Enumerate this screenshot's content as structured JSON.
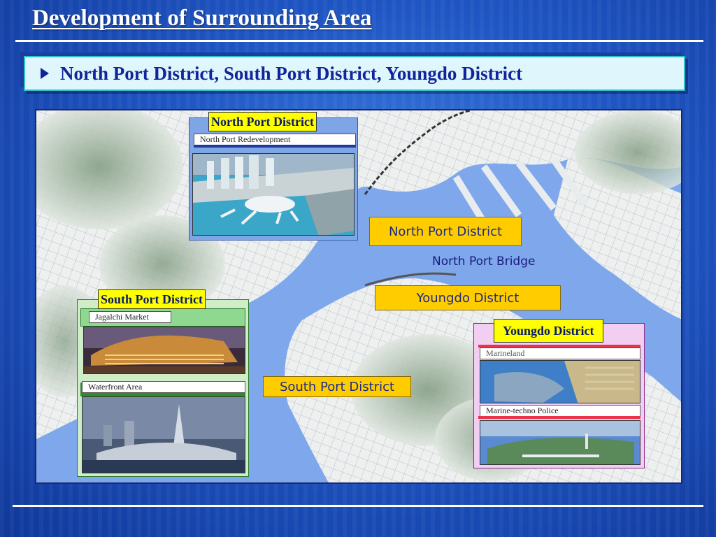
{
  "slide": {
    "title": "Development of Surrounding Area",
    "subtitle": "North Port District, South Port District, Youngdo District"
  },
  "map": {
    "callouts": {
      "north": "North Port District",
      "youngdo": "Youngdo District",
      "south": "South Port District"
    },
    "labels": {
      "bridge": "North Port Bridge"
    }
  },
  "panels": {
    "north": {
      "title": "North Port District",
      "caption": "North Port Redevelopment"
    },
    "south": {
      "title": "South Port District",
      "captions": [
        "Jagalchi Market",
        "Waterfront Area"
      ]
    },
    "youngdo": {
      "title": "Youngdo District",
      "captions": [
        "Marineland",
        "Marine-techno Police"
      ]
    }
  },
  "colors": {
    "background": "#1f56c4",
    "subtitle_text": "#12249a",
    "callout_fill": "#ffcc00",
    "panel_title_fill": "#ffff00",
    "sea": "#7fa8ec"
  }
}
